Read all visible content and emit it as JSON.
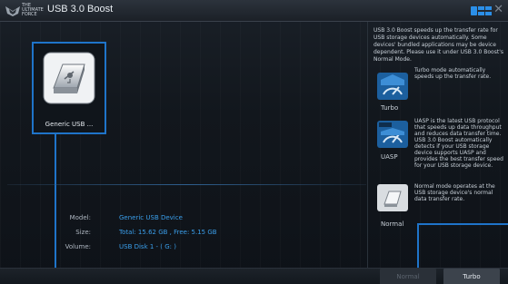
{
  "window": {
    "title": "USB 3.0 Boost",
    "logo_text": "THE ULTIMATE FORCE",
    "close_glyph": "✕"
  },
  "device": {
    "name": "Generic USB ...",
    "icon": "usb-drive-icon"
  },
  "info": {
    "model_label": "Model:",
    "model_value": "Generic USB Device",
    "size_label": "Size:",
    "size_value": "Total: 15.62 GB , Free: 5.15 GB",
    "volume_label": "Volume:",
    "volume_value": "USB Disk 1 - ( G: )"
  },
  "panel": {
    "intro": "USB 3.0 Boost speeds up the transfer rate for USB storage devices automatically. Some devices' bundled applications may be device dependent. Please use it under USB 3.0 Boost's Normal Mode.",
    "modes": [
      {
        "label": "Turbo",
        "icon": "turbo-speedometer-icon",
        "desc": "Turbo mode automatically speeds up the transfer rate."
      },
      {
        "label": "UASP",
        "icon": "uasp-speedometer-icon",
        "desc": "UASP is the latest USB protocol that speeds up data throughput and reduces data transfer time. USB 3.0 Boost automatically detects if your USB storage device supports UASP and provides the best transfer speed for your USB storage device."
      },
      {
        "label": "Normal",
        "icon": "normal-drive-icon",
        "desc": "Normal mode operates at the USB storage device's normal data transfer rate."
      }
    ]
  },
  "buttons": {
    "normal_label": "Normal",
    "turbo_label": "Turbo"
  },
  "colors": {
    "accent_blue": "#1f74c9",
    "value_blue": "#3a9eea"
  }
}
